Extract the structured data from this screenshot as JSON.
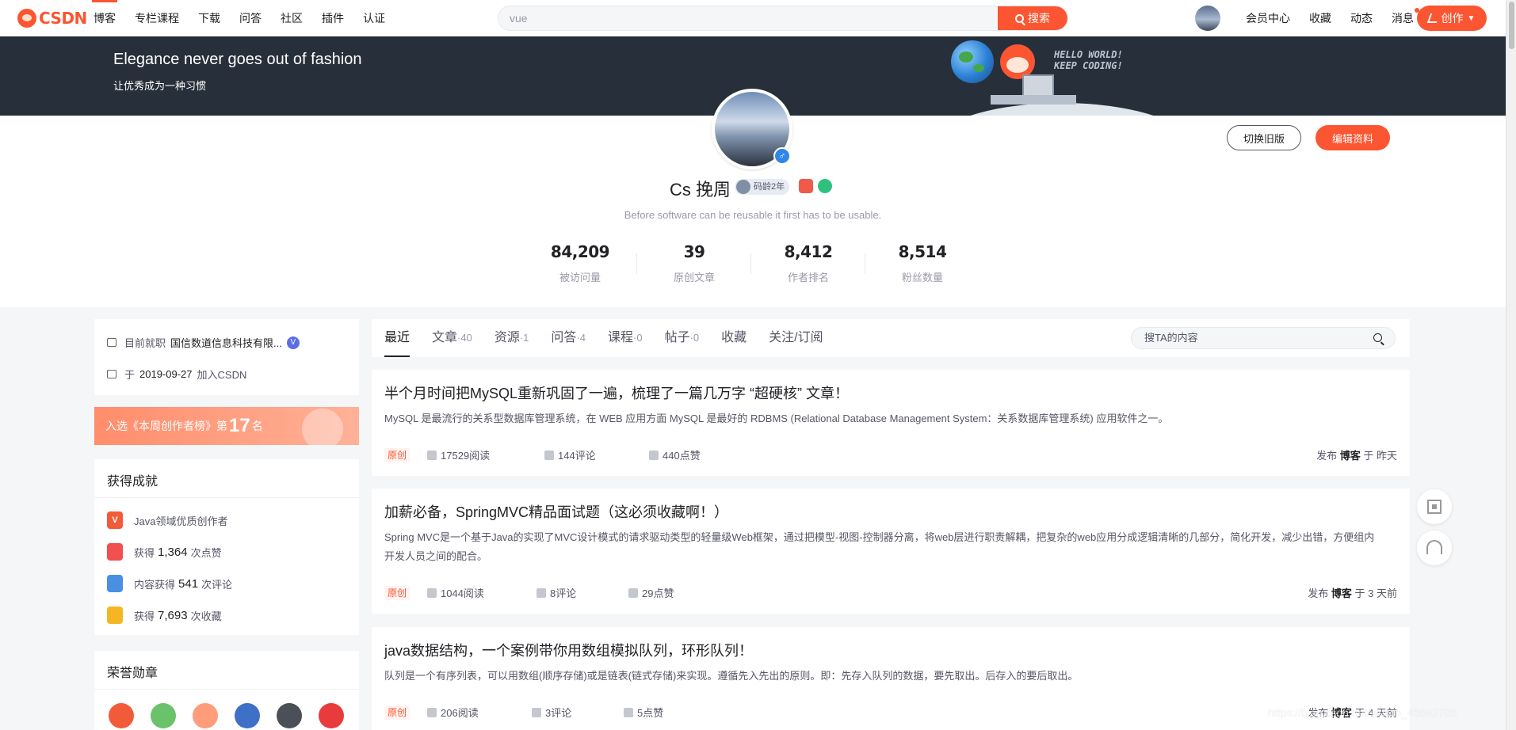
{
  "nav": {
    "logo": "CSDN",
    "links": [
      "博客",
      "专栏课程",
      "下载",
      "问答",
      "社区",
      "插件",
      "认证"
    ],
    "search_value": "vue",
    "search_button": "搜索",
    "right_links": [
      "会员中心",
      "收藏",
      "动态",
      "消息"
    ],
    "create_button": "创作"
  },
  "banner": {
    "title": "Elegance never goes out of fashion",
    "subtitle": "让优秀成为一种习惯",
    "hello_line1": "HELLO WORLD!",
    "hello_line2": "KEEP CODING!"
  },
  "profile": {
    "name": "Cs 挽周",
    "code_age": "码龄2年",
    "gender_symbol": "♂",
    "motto": "Before software can be reusable it first has to be usable.",
    "stats": [
      {
        "value": "84,209",
        "label": "被访问量"
      },
      {
        "value": "39",
        "label": "原创文章"
      },
      {
        "value": "8,412",
        "label": "作者排名"
      },
      {
        "value": "8,514",
        "label": "粉丝数量"
      }
    ],
    "switch_button": "切换旧版",
    "edit_button": "编辑资料"
  },
  "info": {
    "job_label": "目前就职",
    "job_value": "国信数道信息科技有限...",
    "join_prefix": "于",
    "join_date": "2019-09-27",
    "join_suffix": "加入CSDN"
  },
  "rank": {
    "prefix": "入选《本周创作者榜》第",
    "number": "17",
    "suffix": "名"
  },
  "achievements": {
    "title": "获得成就",
    "items": [
      {
        "pre": "Java领域优质创作者",
        "num": "",
        "post": ""
      },
      {
        "pre": "获得",
        "num": "1,364",
        "post": "次点赞"
      },
      {
        "pre": "内容获得",
        "num": "541",
        "post": "次评论"
      },
      {
        "pre": "获得",
        "num": "7,693",
        "post": "次收藏"
      }
    ]
  },
  "honor": {
    "title": "荣誉勋章"
  },
  "tabs": [
    {
      "label": "最近",
      "count": ""
    },
    {
      "label": "文章",
      "count": "·40"
    },
    {
      "label": "资源",
      "count": "·1"
    },
    {
      "label": "问答",
      "count": "·4"
    },
    {
      "label": "课程",
      "count": "·0"
    },
    {
      "label": "帖子",
      "count": "·0"
    },
    {
      "label": "收藏",
      "count": ""
    },
    {
      "label": "关注/订阅",
      "count": ""
    }
  ],
  "tab_search_placeholder": "搜TA的内容",
  "articles": [
    {
      "title": "半个月时间把MySQL重新巩固了一遍，梳理了一篇几万字 “超硬核” 文章！",
      "desc": "MySQL 是最流行的关系型数据库管理系统，在 WEB 应用方面 MySQL 是最好的 RDBMS (Relational Database Management System：关系数据库管理系统) 应用软件之一。",
      "badge": "原创",
      "reads": "17529阅读",
      "comments": "144评论",
      "likes": "440点赞",
      "pub_prefix": "发布",
      "pub_source": "博客",
      "pub_suffix": "于 昨天"
    },
    {
      "title": "加薪必备，SpringMVC精品面试题（这必须收藏啊！）",
      "desc": "Spring MVC是一个基于Java的实现了MVC设计模式的请求驱动类型的轻量级Web框架，通过把模型-视图-控制器分离，将web层进行职责解耦，把复杂的web应用分成逻辑清晰的几部分，简化开发，减少出错，方便组内开发人员之间的配合。",
      "badge": "原创",
      "reads": "1044阅读",
      "comments": "8评论",
      "likes": "29点赞",
      "pub_prefix": "发布",
      "pub_source": "博客",
      "pub_suffix": "于 3 天前"
    },
    {
      "title": "java数据结构，一个案例带你用数组模拟队列，环形队列！",
      "desc": "队列是一个有序列表，可以用数组(顺序存储)或是链表(链式存储)来实现。遵循先入先出的原则。即：先存入队列的数据，要先取出。后存入的要后取出。",
      "badge": "原创",
      "reads": "206阅读",
      "comments": "3评论",
      "likes": "5点赞",
      "pub_prefix": "发布",
      "pub_source": "博客",
      "pub_suffix": "于 4 天前"
    }
  ],
  "watermark": "https://blog.csdn.net/weixin_45692705",
  "colors": {
    "accent": "#fc5531",
    "banner": "#272f3a",
    "page_bg": "#f5f6f7"
  }
}
